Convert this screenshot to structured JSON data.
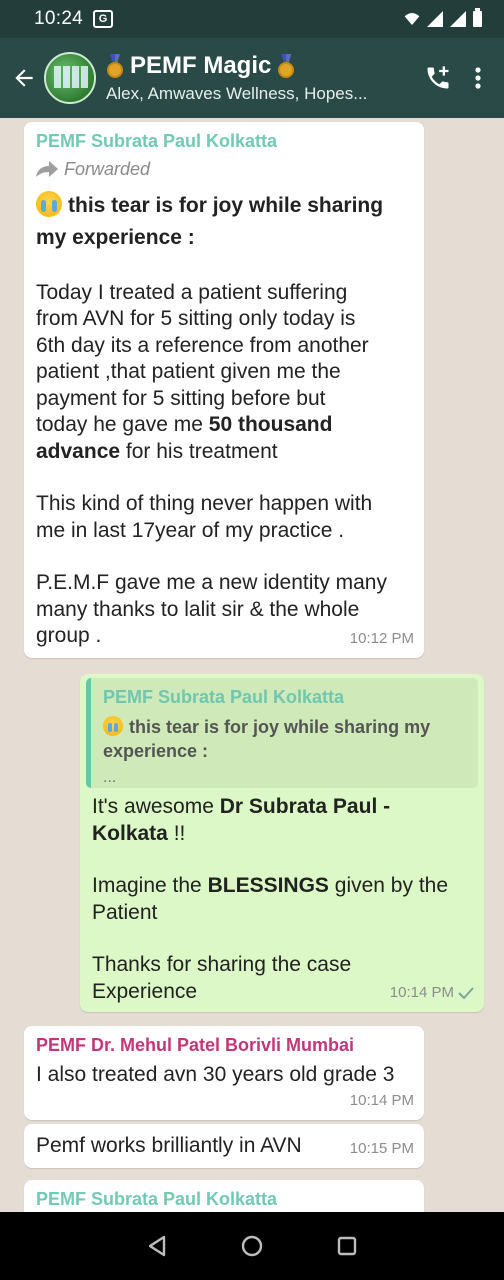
{
  "status_bar": {
    "time": "10:24",
    "g_label": "G"
  },
  "header": {
    "group_name": "PEMF Magic",
    "participants": "Alex, Amwaves Wellness, Hopes..."
  },
  "messages": [
    {
      "sender": "PEMF Subrata Paul Kolkatta",
      "forwarded_label": "Forwarded",
      "heading_line1": "this tear is for joy while sharing",
      "heading_line2": "my  experience :",
      "p1_a": "Today I treated a patient suffering",
      "p1_b": "from AVN for 5 sitting only today is",
      "p1_c": "6th day its a reference from another",
      "p1_d": "patient ,that patient given me the",
      "p1_e": "payment for 5 sitting before but",
      "p1_f_pre": "today he gave me ",
      "p1_f_bold": "50 thousand",
      "p1_g_bold": "advance",
      "p1_g_post": " for his treatment",
      "p2_a": "This kind of thing never happen with",
      "p2_b": "me in last 17year of my practice .",
      "p3_a": "P.E.M.F gave me a new identity many",
      "p3_b": "many thanks to lalit sir & the whole",
      "p3_c": "group .",
      "time": "10:12 PM"
    },
    {
      "quote_sender": "PEMF Subrata Paul Kolkatta",
      "quote_line1": "this tear is for joy while sharing my",
      "quote_line2": "experience :",
      "quote_more": "...",
      "l1_pre": "It's awesome ",
      "l1_bold": "Dr Subrata Paul -",
      "l2_bold": "Kolkata",
      "l2_post": "  !!",
      "l3_pre": "Imagine the ",
      "l3_bold": "BLESSINGS",
      "l3_post": " given by the",
      "l4": "Patient",
      "l5": "Thanks for sharing the case",
      "l6": "Experience",
      "time": "10:14 PM"
    },
    {
      "sender": "PEMF Dr. Mehul Patel Borivli Mumbai",
      "text": "I also treated avn 30 years old grade 3",
      "time": "10:14 PM"
    },
    {
      "text": "Pemf works brilliantly in AVN",
      "time": "10:15 PM"
    },
    {
      "sender": "PEMF Subrata Paul Kolkatta"
    }
  ],
  "colors": {
    "sender_teal": "#72c9b5",
    "sender_magenta": "#c2367a",
    "read_tick": "#7aa6a0"
  }
}
